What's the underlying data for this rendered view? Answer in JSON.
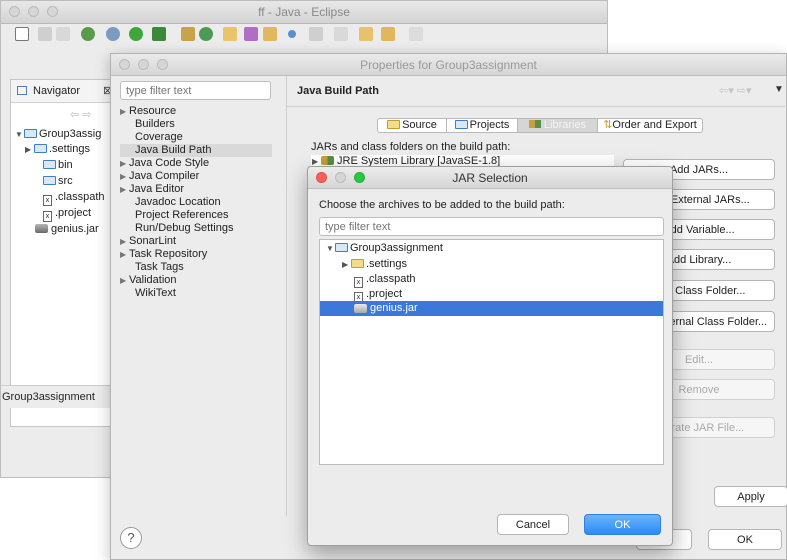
{
  "eclipse": {
    "title": "ff - Java - Eclipse",
    "navigator": {
      "tab_label": "Navigator",
      "tree": [
        {
          "label": "Group3assig",
          "kind": "project"
        },
        {
          "label": ".settings",
          "kind": "folder"
        },
        {
          "label": "bin",
          "kind": "folder"
        },
        {
          "label": "src",
          "kind": "folder"
        },
        {
          "label": ".classpath",
          "kind": "file"
        },
        {
          "label": ".project",
          "kind": "file"
        },
        {
          "label": "genius.jar",
          "kind": "jar"
        }
      ],
      "status": "Group3assignment"
    }
  },
  "properties": {
    "title": "Properties for Group3assignment",
    "filter_placeholder": "type filter text",
    "categories": [
      {
        "label": "Resource",
        "expandable": true
      },
      {
        "label": "Builders",
        "expandable": false
      },
      {
        "label": "Coverage",
        "expandable": false
      },
      {
        "label": "Java Build Path",
        "expandable": false,
        "selected": true
      },
      {
        "label": "Java Code Style",
        "expandable": true
      },
      {
        "label": "Java Compiler",
        "expandable": true
      },
      {
        "label": "Java Editor",
        "expandable": true
      },
      {
        "label": "Javadoc Location",
        "expandable": false
      },
      {
        "label": "Project References",
        "expandable": false
      },
      {
        "label": "Run/Debug Settings",
        "expandable": false
      },
      {
        "label": "SonarLint",
        "expandable": true
      },
      {
        "label": "Task Repository",
        "expandable": true
      },
      {
        "label": "Task Tags",
        "expandable": false
      },
      {
        "label": "Validation",
        "expandable": true
      },
      {
        "label": "WikiText",
        "expandable": false
      }
    ],
    "page_title": "Java Build Path",
    "tabs": [
      "Source",
      "Projects",
      "Libraries",
      "Order and Export"
    ],
    "selected_tab": "Libraries",
    "jars_label": "JARs and class folders on the build path:",
    "library_entry": "JRE System Library [JavaSE-1.8]",
    "side_buttons": [
      {
        "label": "Add JARs...",
        "enabled": true
      },
      {
        "label": "Add External JARs...",
        "enabled": true
      },
      {
        "label": "Add Variable...",
        "enabled": true
      },
      {
        "label": "Add Library...",
        "enabled": true
      },
      {
        "label": "Add Class Folder...",
        "enabled": true
      },
      {
        "label": "Add External Class Folder...",
        "enabled": true
      },
      {
        "label": "Edit...",
        "enabled": false
      },
      {
        "label": "Remove",
        "enabled": false
      },
      {
        "label": "Migrate JAR File...",
        "enabled": false
      }
    ],
    "apply_label": "Apply",
    "ok_label": "OK",
    "help_label": "?"
  },
  "jar_dialog": {
    "title": "JAR Selection",
    "prompt": "Choose the archives to be added to the build path:",
    "filter_placeholder": "type filter text",
    "tree": [
      {
        "label": "Group3assignment",
        "kind": "project"
      },
      {
        "label": ".settings",
        "kind": "folder"
      },
      {
        "label": ".classpath",
        "kind": "file"
      },
      {
        "label": ".project",
        "kind": "file"
      },
      {
        "label": "genius.jar",
        "kind": "jar",
        "selected": true
      }
    ],
    "cancel_label": "Cancel",
    "ok_label": "OK"
  },
  "colors": {
    "selection": "#3b78d8",
    "sidebar_selection": "#d9d9d9",
    "ok_button": "#2a8cf7"
  }
}
